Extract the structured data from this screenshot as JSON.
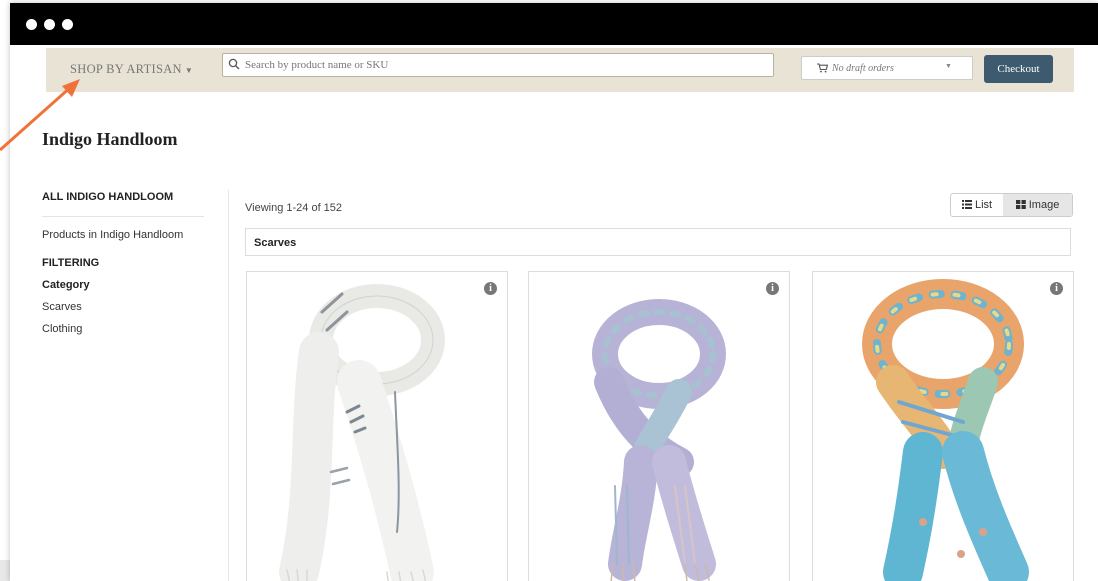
{
  "navbar": {
    "shop_by_label": "SHOP BY ARTISAN",
    "search_placeholder": "Search by product name or SKU",
    "draft_orders_label": "No draft orders",
    "checkout_label": "Checkout"
  },
  "page": {
    "title": "Indigo Handloom"
  },
  "sidebar": {
    "heading": "ALL INDIGO HANDLOOM",
    "products_link": "Products in Indigo Handloom",
    "filtering_label": "FILTERING",
    "category_label": "Category",
    "categories": [
      "Scarves",
      "Clothing"
    ]
  },
  "results": {
    "viewing_text": "Viewing 1-24 of 152",
    "view_list_label": "List",
    "view_image_label": "Image",
    "active_view": "Image",
    "category_header": "Scarves"
  },
  "products": [
    {
      "name": "white scarf",
      "info_icon": "info-icon",
      "colors": [
        "#f4f4f2",
        "#8a96a2"
      ]
    },
    {
      "name": "lavender scarf",
      "info_icon": "info-icon",
      "colors": [
        "#b7b3d6",
        "#a6c2d0"
      ]
    },
    {
      "name": "multicolor scarf",
      "info_icon": "info-icon",
      "colors": [
        "#e8a46a",
        "#6cb4cf"
      ]
    }
  ],
  "annotation": {
    "arrow_color": "#f0723b"
  }
}
